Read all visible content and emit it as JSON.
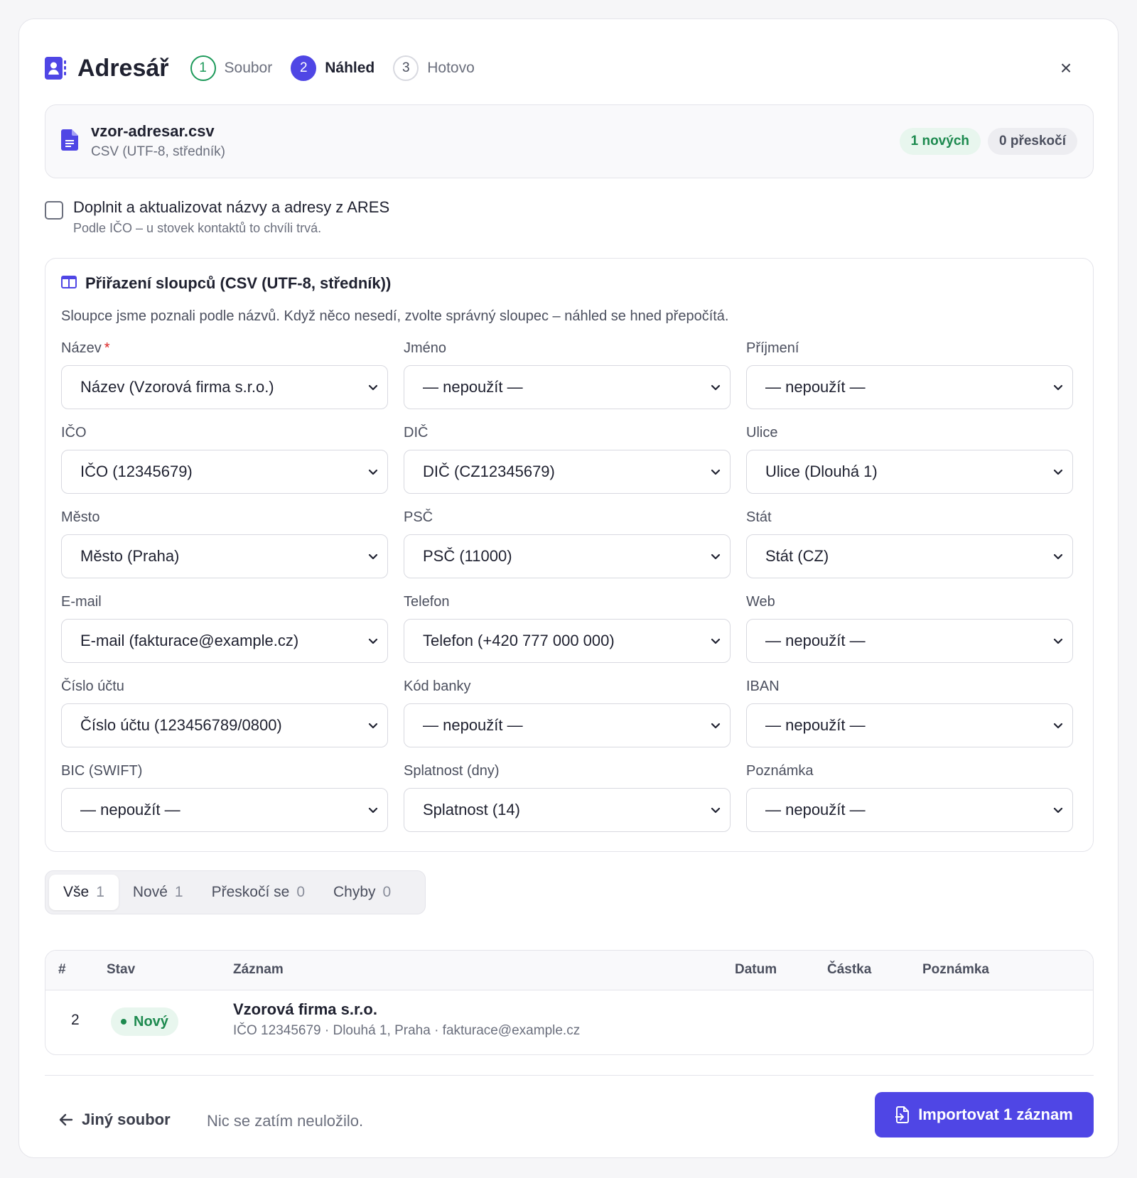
{
  "header": {
    "title": "Adresář",
    "steps": [
      {
        "num": "1",
        "label": "Soubor"
      },
      {
        "num": "2",
        "label": "Náhled"
      },
      {
        "num": "3",
        "label": "Hotovo"
      }
    ],
    "close_label": "×"
  },
  "file": {
    "name": "vzor-adresar.csv",
    "type": "CSV (UTF-8, středník)",
    "badge_new": "1 nových",
    "badge_skip": "0 přeskočí"
  },
  "ares": {
    "label": "Doplnit a aktualizovat názvy a adresy z ARES",
    "hint": "Podle IČO – u stovek kontaktů to chvíli trvá.",
    "checked": false
  },
  "mapping": {
    "title": "Přiřazení sloupců (CSV (UTF-8, středník))",
    "description": "Sloupce jsme poznali podle názvů. Když něco nesedí, zvolte správný sloupec – náhled se hned přepočítá.",
    "required_mark": "*",
    "fields": [
      {
        "label": "Název",
        "value": "Název (Vzorová firma s.r.o.)"
      },
      {
        "label": "Jméno",
        "value": "— nepoužít —"
      },
      {
        "label": "Příjmení",
        "value": "— nepoužít —"
      },
      {
        "label": "IČO",
        "value": "IČO (12345679)"
      },
      {
        "label": "DIČ",
        "value": "DIČ (CZ12345679)"
      },
      {
        "label": "Ulice",
        "value": "Ulice (Dlouhá 1)"
      },
      {
        "label": "Město",
        "value": "Město (Praha)"
      },
      {
        "label": "PSČ",
        "value": "PSČ (11000)"
      },
      {
        "label": "Stát",
        "value": "Stát (CZ)"
      },
      {
        "label": "E-mail",
        "value": "E-mail (fakturace@example.cz)"
      },
      {
        "label": "Telefon",
        "value": "Telefon (+420 777 000 000)"
      },
      {
        "label": "Web",
        "value": "— nepoužít —"
      },
      {
        "label": "Číslo účtu",
        "value": "Číslo účtu (123456789/0800)"
      },
      {
        "label": "Kód banky",
        "value": "— nepoužít —"
      },
      {
        "label": "IBAN",
        "value": "— nepoužít —"
      },
      {
        "label": "BIC (SWIFT)",
        "value": "— nepoužít —"
      },
      {
        "label": "Splatnost (dny)",
        "value": "Splatnost (14)"
      },
      {
        "label": "Poznámka",
        "value": "— nepoužít —"
      }
    ]
  },
  "tabs": [
    {
      "label": "Vše",
      "count": "1"
    },
    {
      "label": "Nové",
      "count": "1"
    },
    {
      "label": "Přeskočí se",
      "count": "0"
    },
    {
      "label": "Chyby",
      "count": "0"
    }
  ],
  "table": {
    "headers": {
      "num": "#",
      "status": "Stav",
      "record": "Záznam",
      "date": "Datum",
      "amount": "Částka",
      "note": "Poznámka"
    },
    "rows": [
      {
        "num": "2",
        "status": "Nový",
        "title": "Vzorová firma s.r.o.",
        "detail": "IČO 12345679 · Dlouhá 1, Praha · fakturace@example.cz"
      }
    ]
  },
  "footer": {
    "back_label": "Jiný soubor",
    "status": "Nic se zatím neuložilo.",
    "import_label": "Importovat 1 záznam"
  },
  "colors": {
    "accent": "#4f46e5",
    "success": "#1d8a4f",
    "required": "#dc2626"
  }
}
